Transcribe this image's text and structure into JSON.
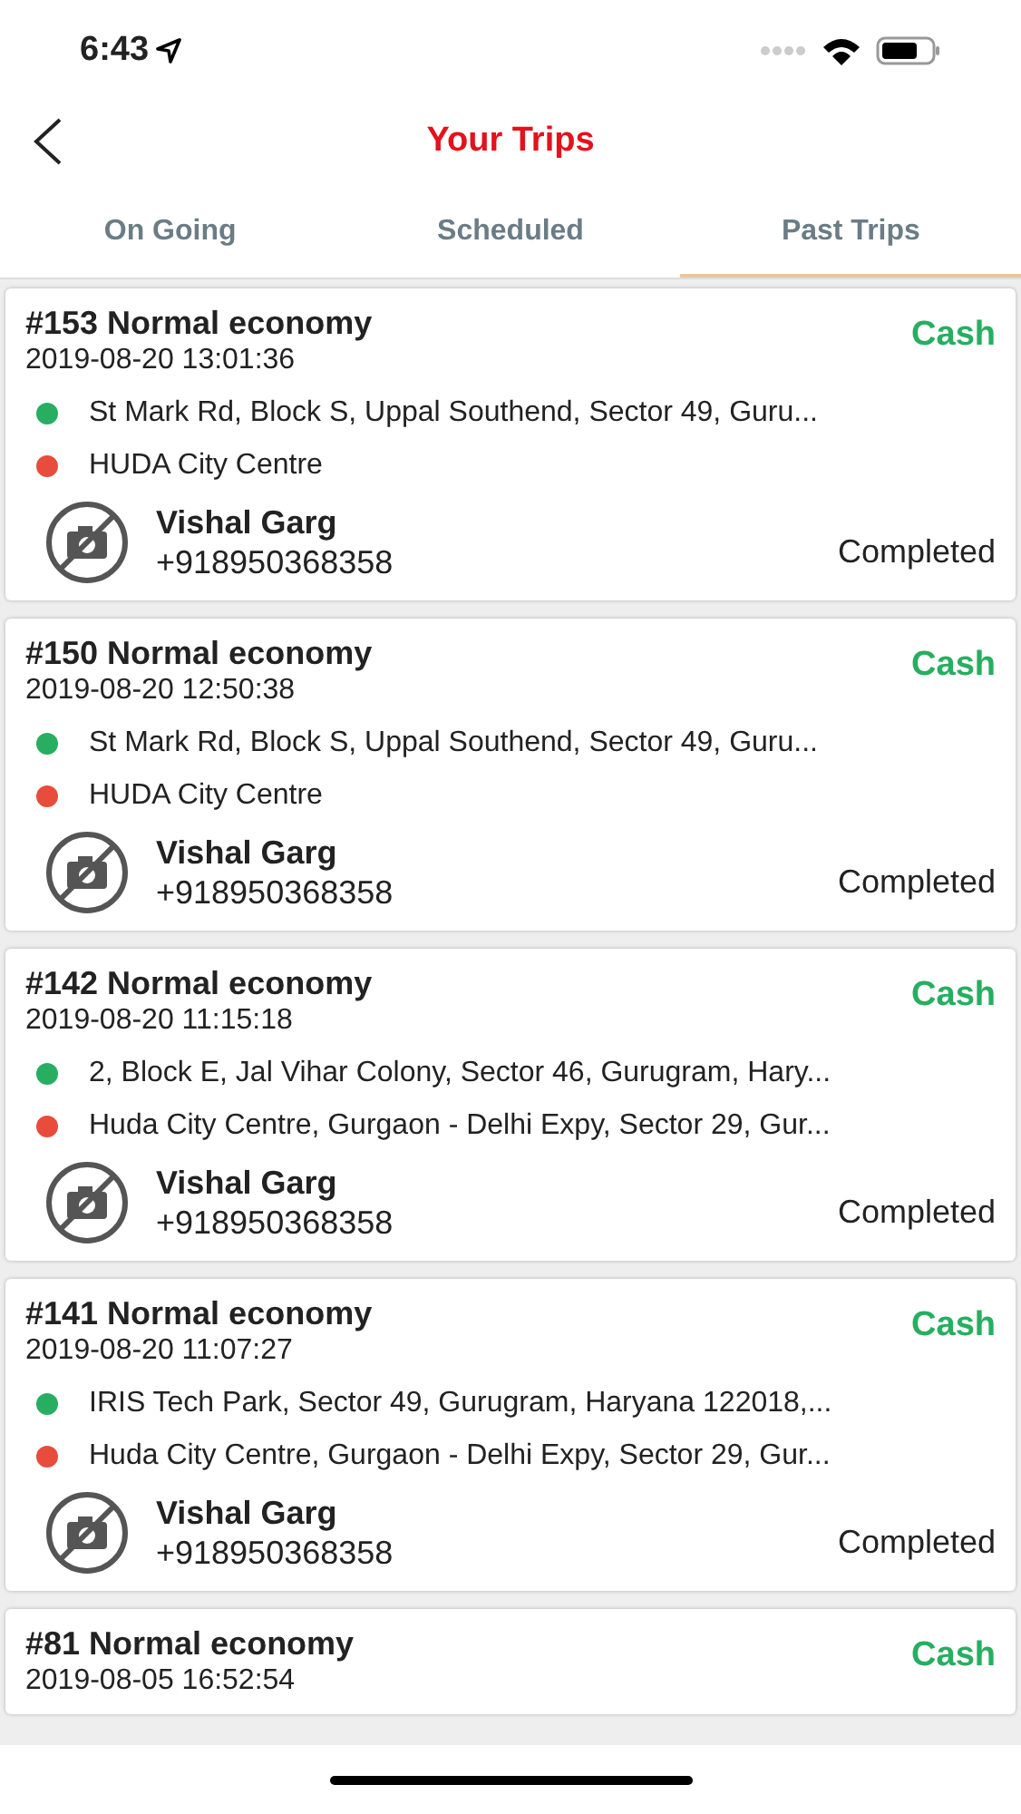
{
  "status_bar": {
    "time": "6:43"
  },
  "header": {
    "title": "Your Trips"
  },
  "tabs": [
    {
      "label": "On Going",
      "selected": false
    },
    {
      "label": "Scheduled",
      "selected": false
    },
    {
      "label": "Past Trips",
      "selected": true
    }
  ],
  "trips": [
    {
      "title": "#153 Normal economy",
      "datetime": "2019-08-20 13:01:36",
      "payment": "Cash",
      "stops": [
        {
          "address": "St Mark Rd, Block S, Uppal Southend, Sector 49, Guru...",
          "color": "#27ae60"
        },
        {
          "address": "HUDA City Centre",
          "color": "#e74c3c"
        }
      ],
      "driver": {
        "name": "Vishal Garg",
        "phone": "+918950368358"
      },
      "status": "Completed"
    },
    {
      "title": "#150 Normal economy",
      "datetime": "2019-08-20 12:50:38",
      "payment": "Cash",
      "stops": [
        {
          "address": "St Mark Rd, Block S, Uppal Southend, Sector 49, Guru...",
          "color": "#27ae60"
        },
        {
          "address": "HUDA City Centre",
          "color": "#e74c3c"
        }
      ],
      "driver": {
        "name": "Vishal Garg",
        "phone": "+918950368358"
      },
      "status": "Completed"
    },
    {
      "title": "#142 Normal economy",
      "datetime": "2019-08-20 11:15:18",
      "payment": "Cash",
      "stops": [
        {
          "address": "2, Block E, Jal Vihar Colony, Sector 46, Gurugram, Hary...",
          "color": "#27ae60"
        },
        {
          "address": "Huda City Centre, Gurgaon - Delhi Expy, Sector 29, Gur...",
          "color": "#e74c3c"
        }
      ],
      "driver": {
        "name": "Vishal Garg",
        "phone": "+918950368358"
      },
      "status": "Completed"
    },
    {
      "title": "#141 Normal economy",
      "datetime": "2019-08-20 11:07:27",
      "payment": "Cash",
      "stops": [
        {
          "address": "IRIS Tech Park, Sector 49, Gurugram, Haryana 122018,...",
          "color": "#27ae60"
        },
        {
          "address": "Huda City Centre, Gurgaon - Delhi Expy, Sector 29, Gur...",
          "color": "#e74c3c"
        }
      ],
      "driver": {
        "name": "Vishal Garg",
        "phone": "+918950368358"
      },
      "status": "Completed"
    },
    {
      "title": "#81 Normal economy",
      "datetime": "2019-08-05 16:52:54",
      "payment": "Cash"
    }
  ]
}
